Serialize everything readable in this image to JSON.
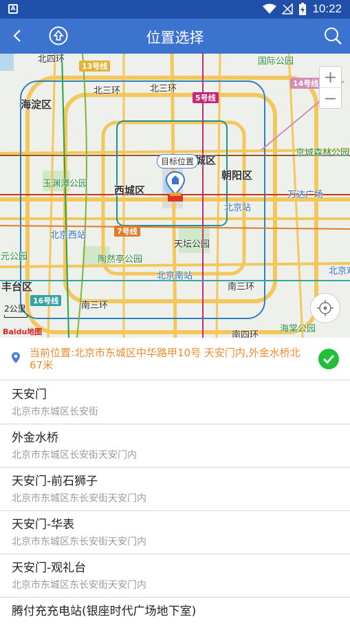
{
  "status_bar": {
    "time": "10:22",
    "icons": [
      "app-badge-icon",
      "wifi-icon",
      "no-signal-icon",
      "battery-charging-icon"
    ]
  },
  "toolbar": {
    "title": "位置选择",
    "back_icon": "arrow-left-icon",
    "up_icon": "circle-up-arrow-icon",
    "search_icon": "search-icon"
  },
  "map": {
    "districts": {
      "haidian": "海淀区",
      "xicheng": "西城区",
      "dongcheng": "城区",
      "chaoyang": "朝阳区",
      "fengtai": "丰台区"
    },
    "ring_roads": {
      "north_4": "北四环",
      "north_3": "北三环",
      "north_3b": "北三环",
      "south_3": "南三环",
      "south_3b": "南三环",
      "south_4": "南四环"
    },
    "line_badges": {
      "line13": "13号线",
      "line5": "5号线",
      "line14": "14号线",
      "line7": "7号线",
      "line16": "16号线"
    },
    "places": {
      "guomao_park": "国际公园",
      "jingcheng_forest": "京城森林公园",
      "yuyuantan": "玉渊潭公园",
      "wanda": "万达广场",
      "beijing_station": "北京站",
      "beijing_west": "北京西站",
      "taoranting": "陶然亭公园",
      "tiantan": "天坛公园",
      "beijing_south": "北京南站",
      "beijing_happy": "北京欢乐",
      "yuan_park": "元公园",
      "haitang_park": "海棠公园"
    },
    "target_tag": "目标位置",
    "zoom_in": "+",
    "zoom_out": "−",
    "scale": "2公里",
    "logo": "Baidu地图"
  },
  "current_location": {
    "text": "当前位置:北京市东城区中华路甲10号 天安门内,外金水桥北67米"
  },
  "results": [
    {
      "name": "天安门",
      "address": "北京市东城区长安街"
    },
    {
      "name": "外金水桥",
      "address": "北京市东城区长安街天安门内"
    },
    {
      "name": "天安门-前石狮子",
      "address": "北京市东城区东长安街天安门内"
    },
    {
      "name": "天安门-华表",
      "address": "北京市东城区东长安街天安门内"
    },
    {
      "name": "天安门-观礼台",
      "address": "北京市东城区东长安街天安门内"
    },
    {
      "name": "腾付充充电站(银座时代广场地下室)",
      "address": ""
    }
  ],
  "colors": {
    "toolbar": "#3c73cf",
    "status_bar": "#1f4fa8",
    "current_location_text": "#f08a2b",
    "confirm": "#22c03a"
  }
}
